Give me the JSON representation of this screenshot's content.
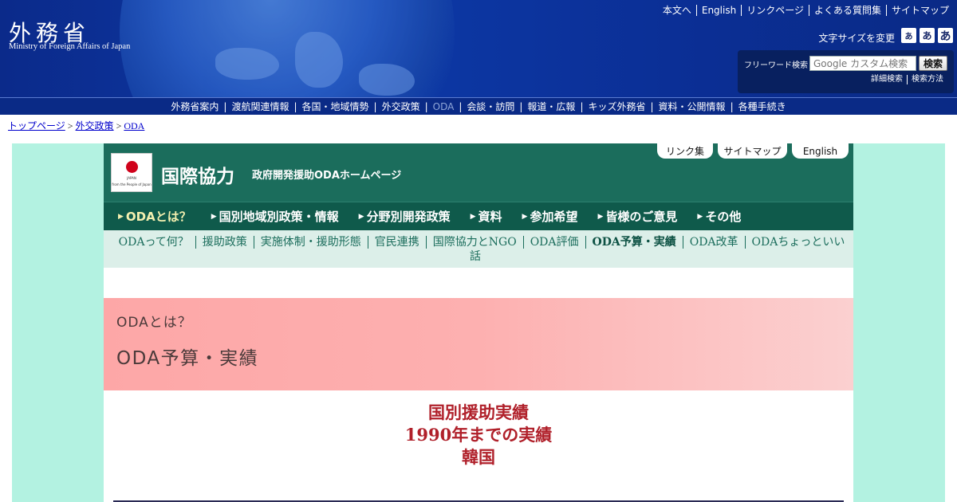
{
  "header": {
    "logo_jp": "外務省",
    "logo_en": "Ministry of Foreign Affairs of Japan",
    "util_links": [
      "本文へ",
      "English",
      "リンクページ",
      "よくある質問集",
      "サイトマップ"
    ],
    "fontsize_label": "文字サイズを変更",
    "fontsize_buttons": [
      "あ",
      "あ",
      "あ"
    ],
    "search": {
      "label": "フリーワード検索",
      "placeholder": "Google カスタム検索",
      "button": "検索",
      "links": [
        "詳細検索",
        "検索方法"
      ]
    }
  },
  "gnav": {
    "items": [
      "外務省案内",
      "渡航関連情報",
      "各国・地域情勢",
      "外交政策",
      "ODA",
      "会談・訪問",
      "報道・広報",
      "キッズ外務省",
      "資料・公開情報",
      "各種手続き"
    ],
    "active": "ODA"
  },
  "breadcrumb": {
    "items": [
      "トップページ",
      "外交政策",
      "ODA"
    ],
    "separator": ">"
  },
  "oda": {
    "flag_caption_1": "JAPAN",
    "flag_caption_2": "from the People of Japan",
    "title": "国際協力",
    "subtitle": "政府開発援助ODAホームページ",
    "tabs": [
      "リンク集",
      "サイトマップ",
      "English"
    ],
    "menu": [
      "ODAとは？",
      "国別地域別政策・情報",
      "分野別開発政策",
      "資料",
      "参加希望",
      "皆様のご意見",
      "その他"
    ],
    "menu_active": "ODAとは？",
    "submenu": [
      "ODAって何？",
      "援助政策",
      "実施体制・援助形態",
      "官民連携",
      "国際協力とNGO",
      "ODA評価",
      "ODA予算・実績",
      "ODA改革",
      "ODAちょっといい話"
    ],
    "submenu_active": "ODA予算・実績"
  },
  "band": {
    "small": "ODAとは？",
    "large": "ODA予算・実績"
  },
  "page": {
    "heading_line1": "国別援助実績",
    "heading_line2": "1990年までの実績",
    "heading_line3": "韓国"
  },
  "colors": {
    "header_bg": "#0b2a86",
    "oda_green": "#1b6d5c",
    "outer_mint": "#b3f2e1",
    "band_pink": "#fda7a7",
    "heading_red": "#b0202a"
  }
}
